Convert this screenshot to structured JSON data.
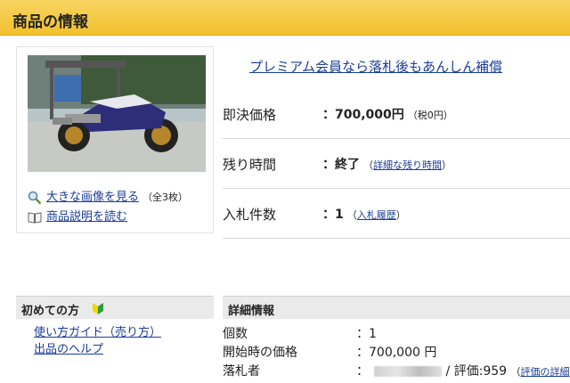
{
  "header": {
    "title": "商品の情報"
  },
  "image_panel": {
    "enlarge_link": "大きな画像を見る",
    "enlarge_count": "（全3枚）",
    "description_link": "商品説明を読む"
  },
  "promo_link": "プレミアム会員なら落札後もあんしん補償",
  "info": {
    "buyout": {
      "label": "即決価格",
      "value": "：700,000円",
      "note": "（税0円）"
    },
    "time_left": {
      "label": "残り時間",
      "value": "：終了",
      "note_open": "（",
      "note_link": "詳細な残り時間",
      "note_close": "）"
    },
    "bids": {
      "label": "入札件数",
      "value": "：1",
      "note_open": "（",
      "note_link": "入札履歴",
      "note_close": "）"
    }
  },
  "beginner": {
    "heading": "初めての方",
    "links": [
      "使い方ガイド（売り方）",
      "出品のヘルプ"
    ]
  },
  "details": {
    "heading": "詳細情報",
    "quantity_label": "個数",
    "quantity_value": "：1",
    "start_price_label": "開始時の価格",
    "start_price_value": "：700,000 円",
    "winner_label": "落札者",
    "winner_rating": "/ 評価:959",
    "winner_link": "評価の詳細"
  },
  "colors": {
    "header": "#f2c12e",
    "link": "#1a3d99",
    "section_bg": "#eaeaea"
  }
}
